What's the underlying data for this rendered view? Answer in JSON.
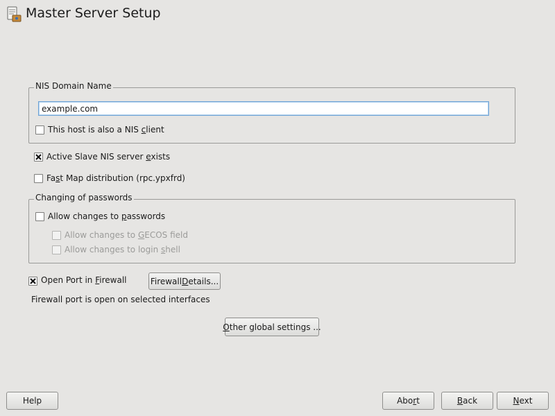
{
  "header": {
    "title": "Master Server Setup",
    "icon": "server-setup-icon"
  },
  "nis_domain": {
    "legend": "NIS Domain Name",
    "value": "example.com",
    "nis_client": {
      "pre": "This host is also a NIS ",
      "mnemonic": "c",
      "post": "lient",
      "checked": false
    }
  },
  "slave": {
    "pre": "Active Slave NIS server ",
    "mnemonic": "e",
    "post": "xists",
    "checked": true
  },
  "fastmap": {
    "pre": "Fa",
    "mnemonic": "s",
    "post": "t Map distribution (rpc.ypxfrd)",
    "checked": false
  },
  "passwords": {
    "legend": "Changing of passwords",
    "allow": {
      "pre": "Allow changes to ",
      "mnemonic": "p",
      "post": "asswords",
      "checked": false
    },
    "gecos": {
      "pre": "Allow changes to ",
      "mnemonic": "G",
      "post": "ECOS field",
      "checked": false,
      "enabled": false
    },
    "shell": {
      "pre": "Allow changes to login ",
      "mnemonic": "s",
      "post": "hell",
      "checked": false,
      "enabled": false
    }
  },
  "firewall": {
    "open_port": {
      "pre": "Open Port in ",
      "mnemonic": "F",
      "post": "irewall",
      "checked": true
    },
    "details_button": {
      "pre": "Firewall ",
      "mnemonic": "D",
      "post": "etails..."
    },
    "status": "Firewall port is open on selected interfaces"
  },
  "other_settings_button": {
    "pre": "",
    "mnemonic": "O",
    "post": "ther global settings ..."
  },
  "footer": {
    "help": "Help",
    "abort": {
      "pre": "Abo",
      "mnemonic": "r",
      "post": "t"
    },
    "back": {
      "pre": "",
      "mnemonic": "B",
      "post": "ack"
    },
    "next": {
      "pre": "",
      "mnemonic": "N",
      "post": "ext"
    }
  },
  "colors": {
    "background": "#e6e5e3",
    "focus_border": "#6fa4d6",
    "disabled_text": "#9b9b99"
  }
}
